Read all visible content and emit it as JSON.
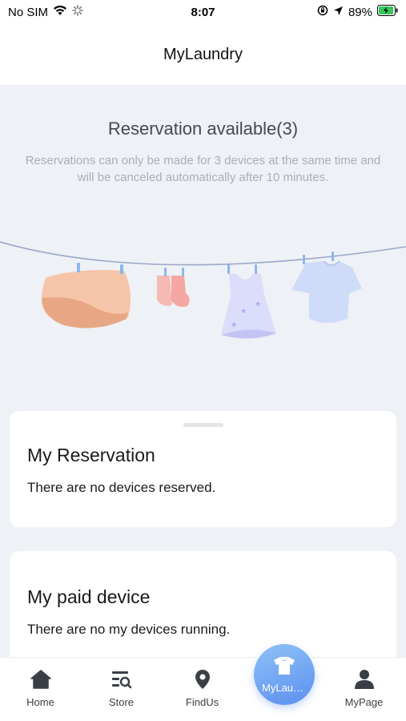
{
  "status_bar": {
    "carrier": "No SIM",
    "time": "8:07",
    "battery": "89%",
    "wifi_icon": "wifi-icon",
    "loading_icon": "activity-spinner-icon",
    "lock_icon": "orientation-lock-icon",
    "location_icon": "location-arrow-icon",
    "battery_icon": "battery-charging-icon"
  },
  "header": {
    "title": "MyLaundry"
  },
  "hero": {
    "title": "Reservation available(3)",
    "description": "Reservations can only be made for 3 devices at the same time and will be canceled automatically after 10 minutes.",
    "illustration": "clothesline-illustration"
  },
  "reservation_card": {
    "title": "My Reservation",
    "empty_text": "There are no devices reserved."
  },
  "paid_card": {
    "title": "My paid device",
    "empty_text": "There are no my devices running."
  },
  "tab_bar": {
    "items": [
      {
        "label": "Home",
        "icon": "home-icon"
      },
      {
        "label": "Store",
        "icon": "store-search-icon"
      },
      {
        "label": "FindUs",
        "icon": "map-pin-icon"
      },
      {
        "label": "MyLaundry",
        "icon": "tshirt-icon",
        "active": true
      },
      {
        "label": "MyPage",
        "icon": "user-icon"
      }
    ]
  },
  "colors": {
    "background": "#eef1f5",
    "accent": "#5b8fef",
    "accent_light": "#8fc2f7",
    "battery_green": "#34c759"
  }
}
